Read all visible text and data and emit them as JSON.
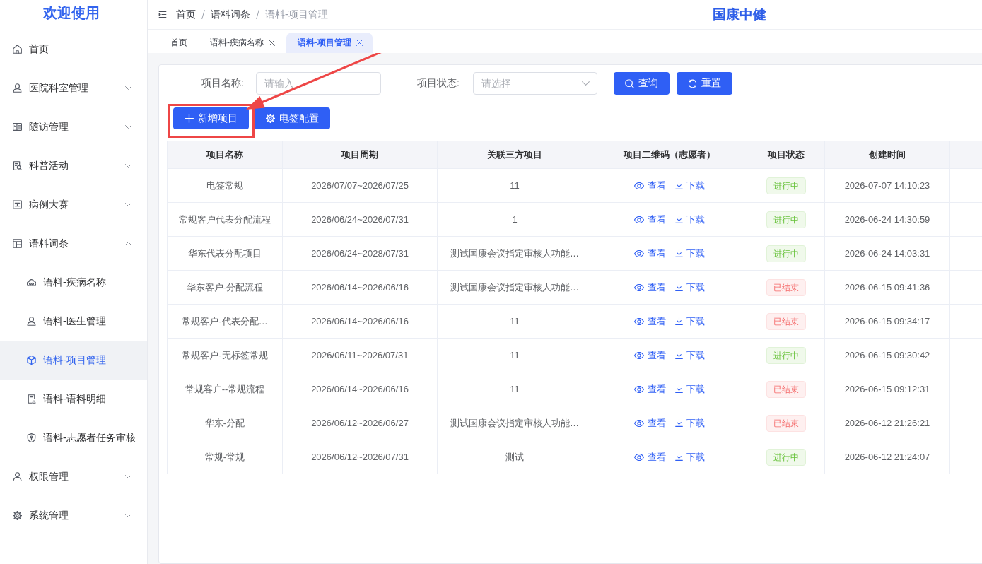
{
  "sidebar": {
    "title": "欢迎使用",
    "items": [
      {
        "label": "首页",
        "selected": false
      },
      {
        "label": "医院科室管理",
        "selected": false,
        "expanded": false
      },
      {
        "label": "随访管理",
        "selected": false,
        "expanded": false
      },
      {
        "label": "科普活动",
        "selected": false,
        "expanded": false
      },
      {
        "label": "病例大赛",
        "selected": false,
        "expanded": false
      },
      {
        "label": "语料词条",
        "selected": false,
        "expanded": true,
        "children": [
          {
            "label": "语料-疾病名称",
            "selected": false
          },
          {
            "label": "语料-医生管理",
            "selected": false
          },
          {
            "label": "语料-项目管理",
            "selected": true
          },
          {
            "label": "语料-语料明细",
            "selected": false
          },
          {
            "label": "语料-志愿者任务审核",
            "selected": false
          }
        ]
      },
      {
        "label": "权限管理",
        "selected": false,
        "expanded": false
      },
      {
        "label": "系统管理",
        "selected": false,
        "expanded": false
      }
    ]
  },
  "header": {
    "breadcrumb": [
      "首页",
      "语料词条",
      "语料-项目管理"
    ],
    "title": "国康中健"
  },
  "tabs": [
    {
      "label": "首页",
      "selected": false,
      "closable": false
    },
    {
      "label": "语料-疾病名称",
      "selected": false,
      "closable": true
    },
    {
      "label": "语料-项目管理",
      "selected": true,
      "closable": true
    }
  ],
  "filters": [
    {
      "kind": "text",
      "label": "项目名称:",
      "placeholder": "请输入"
    },
    {
      "kind": "select",
      "label": "项目状态:",
      "placeholder": "请选择"
    }
  ],
  "search_buttons": [
    {
      "kind": "search",
      "label": "查询"
    },
    {
      "kind": "reset",
      "label": "重置"
    }
  ],
  "toolbar": [
    {
      "kind": "add",
      "label": "新增项目",
      "highlighted": true
    },
    {
      "kind": "config",
      "label": "电签配置",
      "highlighted": false
    }
  ],
  "table": {
    "columns": [
      "项目名称",
      "项目周期",
      "关联三方项目",
      "项目二维码（志愿者）",
      "项目状态",
      "创建时间"
    ],
    "rows": [
      {
        "name": "电签常规",
        "period": "2026/07/07~2026/07/25",
        "linked_project": "11",
        "qr_actions": [
          {
            "kind": "view",
            "label": "查看"
          },
          {
            "kind": "download",
            "label": "下载"
          }
        ],
        "status": {
          "kind": "ongoing",
          "label": "进行中"
        },
        "created": "2026-07-07 14:10:23"
      },
      {
        "name": "常规客户代表分配流程",
        "period": "2026/06/24~2026/07/31",
        "linked_project": "1",
        "qr_actions": [
          {
            "kind": "view",
            "label": "查看"
          },
          {
            "kind": "download",
            "label": "下载"
          }
        ],
        "status": {
          "kind": "ongoing",
          "label": "进行中"
        },
        "created": "2026-06-24 14:30:59"
      },
      {
        "name": "华东代表分配项目",
        "period": "2026/06/24~2028/07/31",
        "linked_project": "测试国康会议指定审核人功能…",
        "qr_actions": [
          {
            "kind": "view",
            "label": "查看"
          },
          {
            "kind": "download",
            "label": "下载"
          }
        ],
        "status": {
          "kind": "ongoing",
          "label": "进行中"
        },
        "created": "2026-06-24 14:03:31"
      },
      {
        "name": "华东客户-分配流程",
        "period": "2026/06/14~2026/06/16",
        "linked_project": "测试国康会议指定审核人功能…",
        "qr_actions": [
          {
            "kind": "view",
            "label": "查看"
          },
          {
            "kind": "download",
            "label": "下载"
          }
        ],
        "status": {
          "kind": "ended",
          "label": "已结束"
        },
        "created": "2026-06-15 09:41:36"
      },
      {
        "name": "常规客户-代表分配…",
        "period": "2026/06/14~2026/06/16",
        "linked_project": "11",
        "qr_actions": [
          {
            "kind": "view",
            "label": "查看"
          },
          {
            "kind": "download",
            "label": "下载"
          }
        ],
        "status": {
          "kind": "ended",
          "label": "已结束"
        },
        "created": "2026-06-15 09:34:17"
      },
      {
        "name": "常规客户-无标签常规",
        "period": "2026/06/11~2026/07/31",
        "linked_project": "11",
        "qr_actions": [
          {
            "kind": "view",
            "label": "查看"
          },
          {
            "kind": "download",
            "label": "下载"
          }
        ],
        "status": {
          "kind": "ongoing",
          "label": "进行中"
        },
        "created": "2026-06-15 09:30:42"
      },
      {
        "name": "常规客户--常规流程",
        "period": "2026/06/14~2026/06/16",
        "linked_project": "11",
        "qr_actions": [
          {
            "kind": "view",
            "label": "查看"
          },
          {
            "kind": "download",
            "label": "下载"
          }
        ],
        "status": {
          "kind": "ended",
          "label": "已结束"
        },
        "created": "2026-06-15 09:12:31"
      },
      {
        "name": "华东-分配",
        "period": "2026/06/12~2026/06/27",
        "linked_project": "测试国康会议指定审核人功能…",
        "qr_actions": [
          {
            "kind": "view",
            "label": "查看"
          },
          {
            "kind": "download",
            "label": "下载"
          }
        ],
        "status": {
          "kind": "ended",
          "label": "已结束"
        },
        "created": "2026-06-12 21:26:21"
      },
      {
        "name": "常规-常规",
        "period": "2026/06/12~2026/07/31",
        "linked_project": "测试",
        "qr_actions": [
          {
            "kind": "view",
            "label": "查看"
          },
          {
            "kind": "download",
            "label": "下载"
          }
        ],
        "status": {
          "kind": "ongoing",
          "label": "进行中"
        },
        "created": "2026-06-12 21:24:07"
      }
    ]
  }
}
